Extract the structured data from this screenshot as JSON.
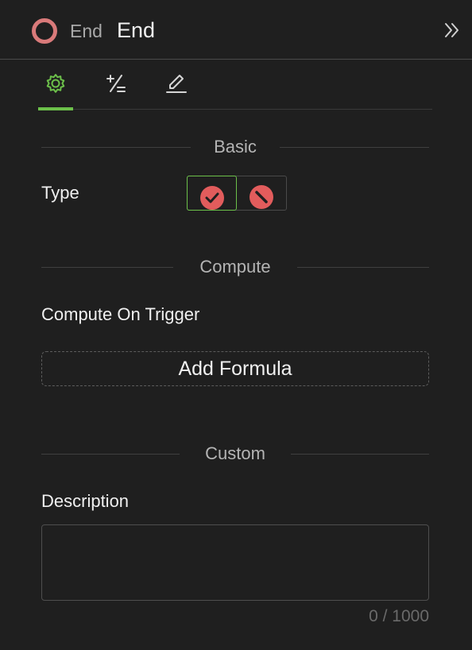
{
  "header": {
    "node_kind": "End",
    "node_title": "End",
    "icon_color": "#d97a7a"
  },
  "tabs": [
    {
      "name": "settings",
      "icon": "gear-icon",
      "active": true
    },
    {
      "name": "formula",
      "icon": "plus-minus-icon",
      "active": false
    },
    {
      "name": "edit",
      "icon": "pencil-icon",
      "active": false
    }
  ],
  "sections": {
    "basic": "Basic",
    "compute": "Compute",
    "custom": "Custom"
  },
  "basic": {
    "type_label": "Type",
    "type_options": [
      {
        "icon": "check-circle-icon",
        "selected": true
      },
      {
        "icon": "cancel-circle-icon",
        "selected": false
      }
    ]
  },
  "compute": {
    "trigger_label": "Compute On Trigger",
    "add_formula_label": "Add Formula"
  },
  "custom": {
    "description_label": "Description",
    "description_value": "",
    "char_count": "0 / 1000"
  },
  "colors": {
    "accent": "#6cc04a",
    "end_red": "#e25c5c",
    "background": "#1f1f1f"
  }
}
